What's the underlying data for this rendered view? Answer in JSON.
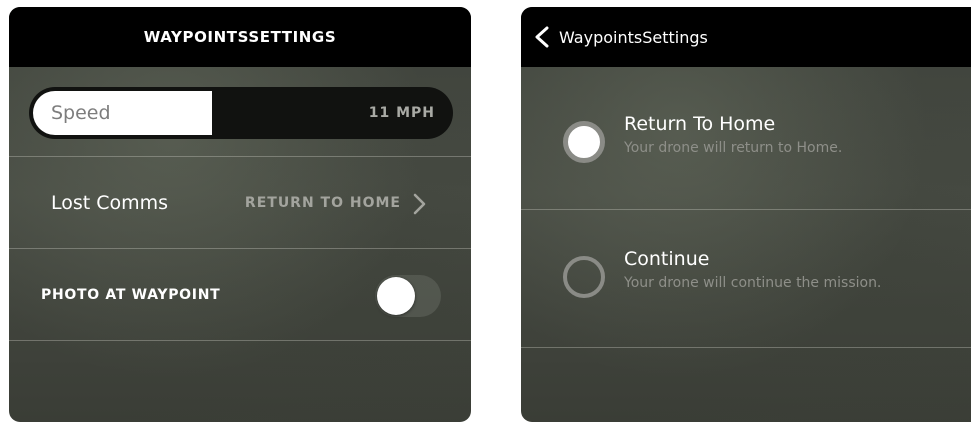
{
  "left_panel": {
    "title": "WAYPOINTSSETTINGS",
    "speed": {
      "label": "Speed",
      "value": "11 MPH",
      "fill_fraction": 0.43
    },
    "lost_comms": {
      "label": "Lost Comms",
      "value": "RETURN TO HOME",
      "icon": "chevron-right-icon"
    },
    "photo_at_waypoint": {
      "label": "PHOTO AT WAYPOINT",
      "toggle_on": false
    }
  },
  "right_panel": {
    "title": "WaypointsSettings",
    "back_icon": "chevron-left-icon",
    "options": [
      {
        "title": "Return To Home",
        "subtitle": "Your drone will return to Home.",
        "selected": true
      },
      {
        "title": "Continue",
        "subtitle": "Your drone will continue the mission.",
        "selected": false
      }
    ]
  },
  "colors": {
    "header_bg": "#000000",
    "panel_bg": "#43463f",
    "text_primary": "#ffffff",
    "text_secondary": "#8e8f89"
  }
}
